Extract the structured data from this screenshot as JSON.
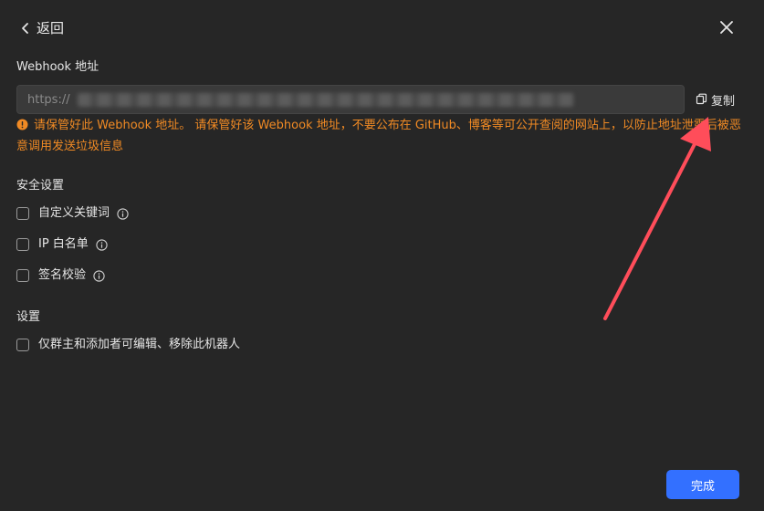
{
  "header": {
    "back_label": "返回"
  },
  "webhook": {
    "label": "Webhook 地址",
    "value": "https://",
    "copy_label": "复制",
    "warning_text": "请保管好此 Webhook 地址。 请保管好该 Webhook 地址，不要公布在 GitHub、博客等可公开查阅的网站上，以防止地址泄露后被恶意调用发送垃圾信息"
  },
  "security": {
    "title": "安全设置",
    "options": [
      {
        "label": "自定义关键词",
        "checked": false
      },
      {
        "label": "IP 白名单",
        "checked": false
      },
      {
        "label": "签名校验",
        "checked": false
      }
    ]
  },
  "settings": {
    "title": "设置",
    "options": [
      {
        "label": "仅群主和添加者可编辑、移除此机器人",
        "checked": false
      }
    ]
  },
  "footer": {
    "done_label": "完成"
  },
  "colors": {
    "background": "#262626",
    "accent": "#3370ff",
    "warning": "#f08a24",
    "annotation_arrow": "#ff4d5a"
  }
}
